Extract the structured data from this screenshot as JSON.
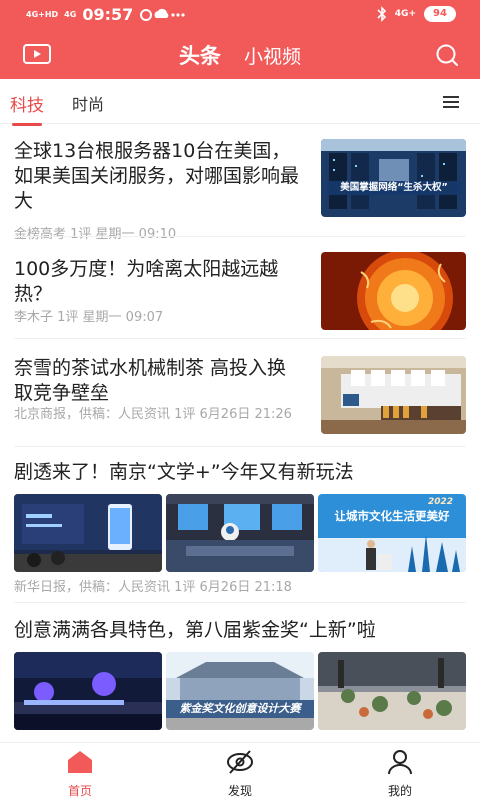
{
  "status_bar": {
    "network1": "4G+HD",
    "network2": "4G",
    "time": "09:57",
    "right_network": "4G+",
    "battery": "94"
  },
  "header": {
    "tabs": [
      "头条",
      "小视频"
    ]
  },
  "categories": [
    "科技",
    "时尚"
  ],
  "articles": [
    {
      "title": "全球13台根服务器10台在美国，如果美国关闭服务，对哪国影响最大",
      "meta": "金榜高考 1评 星期一 09:10",
      "thumb_caption": "美国掌握网络“生杀大权”"
    },
    {
      "title": "100多万度！为啥离太阳越远越热？",
      "meta": "李木子 1评 星期一 09:07"
    },
    {
      "title": "奈雪的茶试水机械制茶 高投入换取竞争壁垒",
      "meta": "北京商报，供稿：人民资讯 1评 6月26日 21:26"
    },
    {
      "title": "剧透来了！南京“文学+”今年又有新玩法",
      "meta": "新华日报，供稿：人民资讯 1评 6月26日 21:18",
      "thumb3_caption": "让城市文化生活更美好",
      "thumb3_year": "2022"
    },
    {
      "title": "创意满满各具特色，第八届紫金奖“上新”啦",
      "thumb2_caption": "紫金奖文化创意设计大赛"
    }
  ],
  "bottom_nav": [
    {
      "label": "首页"
    },
    {
      "label": "发现"
    },
    {
      "label": "我的"
    }
  ],
  "colors": {
    "brand": "#f25a5a",
    "accent": "#e84a4a"
  }
}
